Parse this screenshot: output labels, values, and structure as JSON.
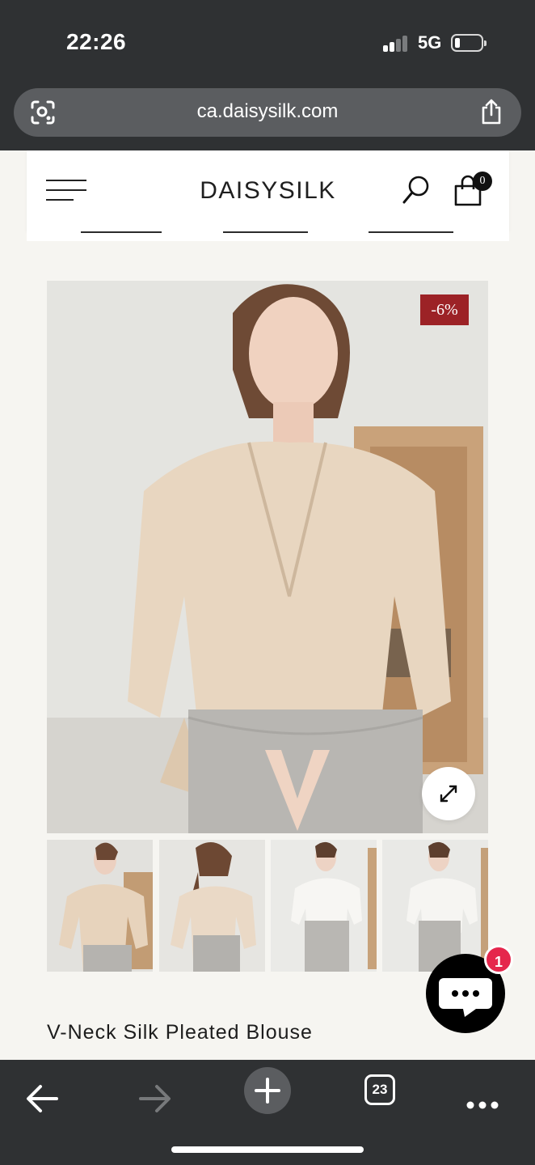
{
  "status_bar": {
    "time": "22:26",
    "network": "5G"
  },
  "browser": {
    "url": "ca.daisysilk.com",
    "tabs_count": "23"
  },
  "site": {
    "brand": "DAISYSILK",
    "cart_count": "0"
  },
  "product": {
    "badge": "-6%",
    "title": "V-Neck Silk Pleated Blouse",
    "thumbnails": [
      "front-view",
      "back-view",
      "white-variant-front",
      "white-variant-side"
    ]
  },
  "chat": {
    "unread": "1"
  },
  "colors": {
    "chrome": "#2f3133",
    "sale": "#9c2226",
    "chat_badge": "#e5264c",
    "blouse": "#e8d6c0"
  }
}
